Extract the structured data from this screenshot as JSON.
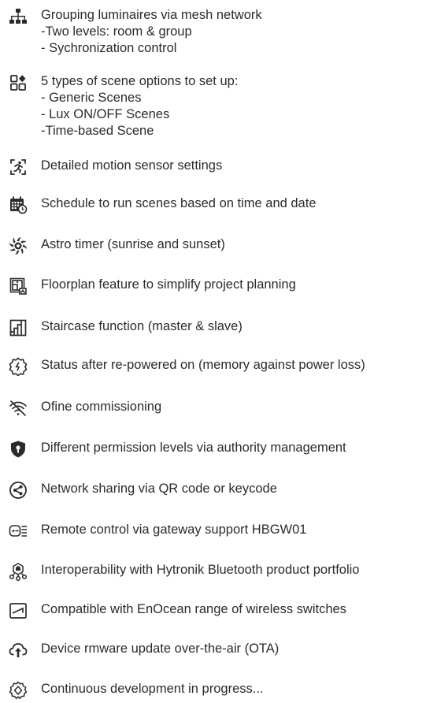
{
  "features": [
    {
      "icon": "mesh-network-icon",
      "title": "Grouping luminaires via mesh network",
      "subs": [
        "-Two levels: room & group",
        "- Sychronization control"
      ]
    },
    {
      "icon": "scene-options-icon",
      "title": "5 types of scene options to set up:",
      "subs": [
        "- Generic Scenes",
        "- Lux ON/OFF Scenes",
        "-Time-based Scene"
      ]
    },
    {
      "icon": "motion-sensor-icon",
      "title": "Detailed motion sensor settings",
      "subs": []
    },
    {
      "icon": "calendar-schedule-icon",
      "title": "Schedule to run scenes based on time and date",
      "subs": []
    },
    {
      "icon": "astro-timer-icon",
      "title": "Astro timer (sunrise and sunset)",
      "subs": []
    },
    {
      "icon": "floorplan-icon",
      "title": "Floorplan feature to simplify project planning",
      "subs": []
    },
    {
      "icon": "staircase-icon",
      "title": "Staircase function (master & slave)",
      "subs": []
    },
    {
      "icon": "power-memory-icon",
      "title": "Status after re-powered on (memory against power loss)",
      "subs": []
    },
    {
      "icon": "offline-icon",
      "title": "Ofine commissioning",
      "subs": []
    },
    {
      "icon": "permission-shield-icon",
      "title": "Different permission levels via authority management",
      "subs": []
    },
    {
      "icon": "share-icon",
      "title": "Network sharing via QR code or keycode",
      "subs": []
    },
    {
      "icon": "gateway-icon",
      "title": "Remote control via gateway support HBGW01",
      "subs": []
    },
    {
      "icon": "interoperability-icon",
      "title": "Interoperability with Hytronik Bluetooth product portfolio",
      "subs": []
    },
    {
      "icon": "enocean-switch-icon",
      "title": "Compatible with EnOcean range of wireless switches",
      "subs": []
    },
    {
      "icon": "cloud-upload-icon",
      "title": "Device rmware update over-the-air (OTA)",
      "subs": []
    },
    {
      "icon": "development-gear-icon",
      "title": "Continuous development in progress...",
      "subs": []
    }
  ]
}
